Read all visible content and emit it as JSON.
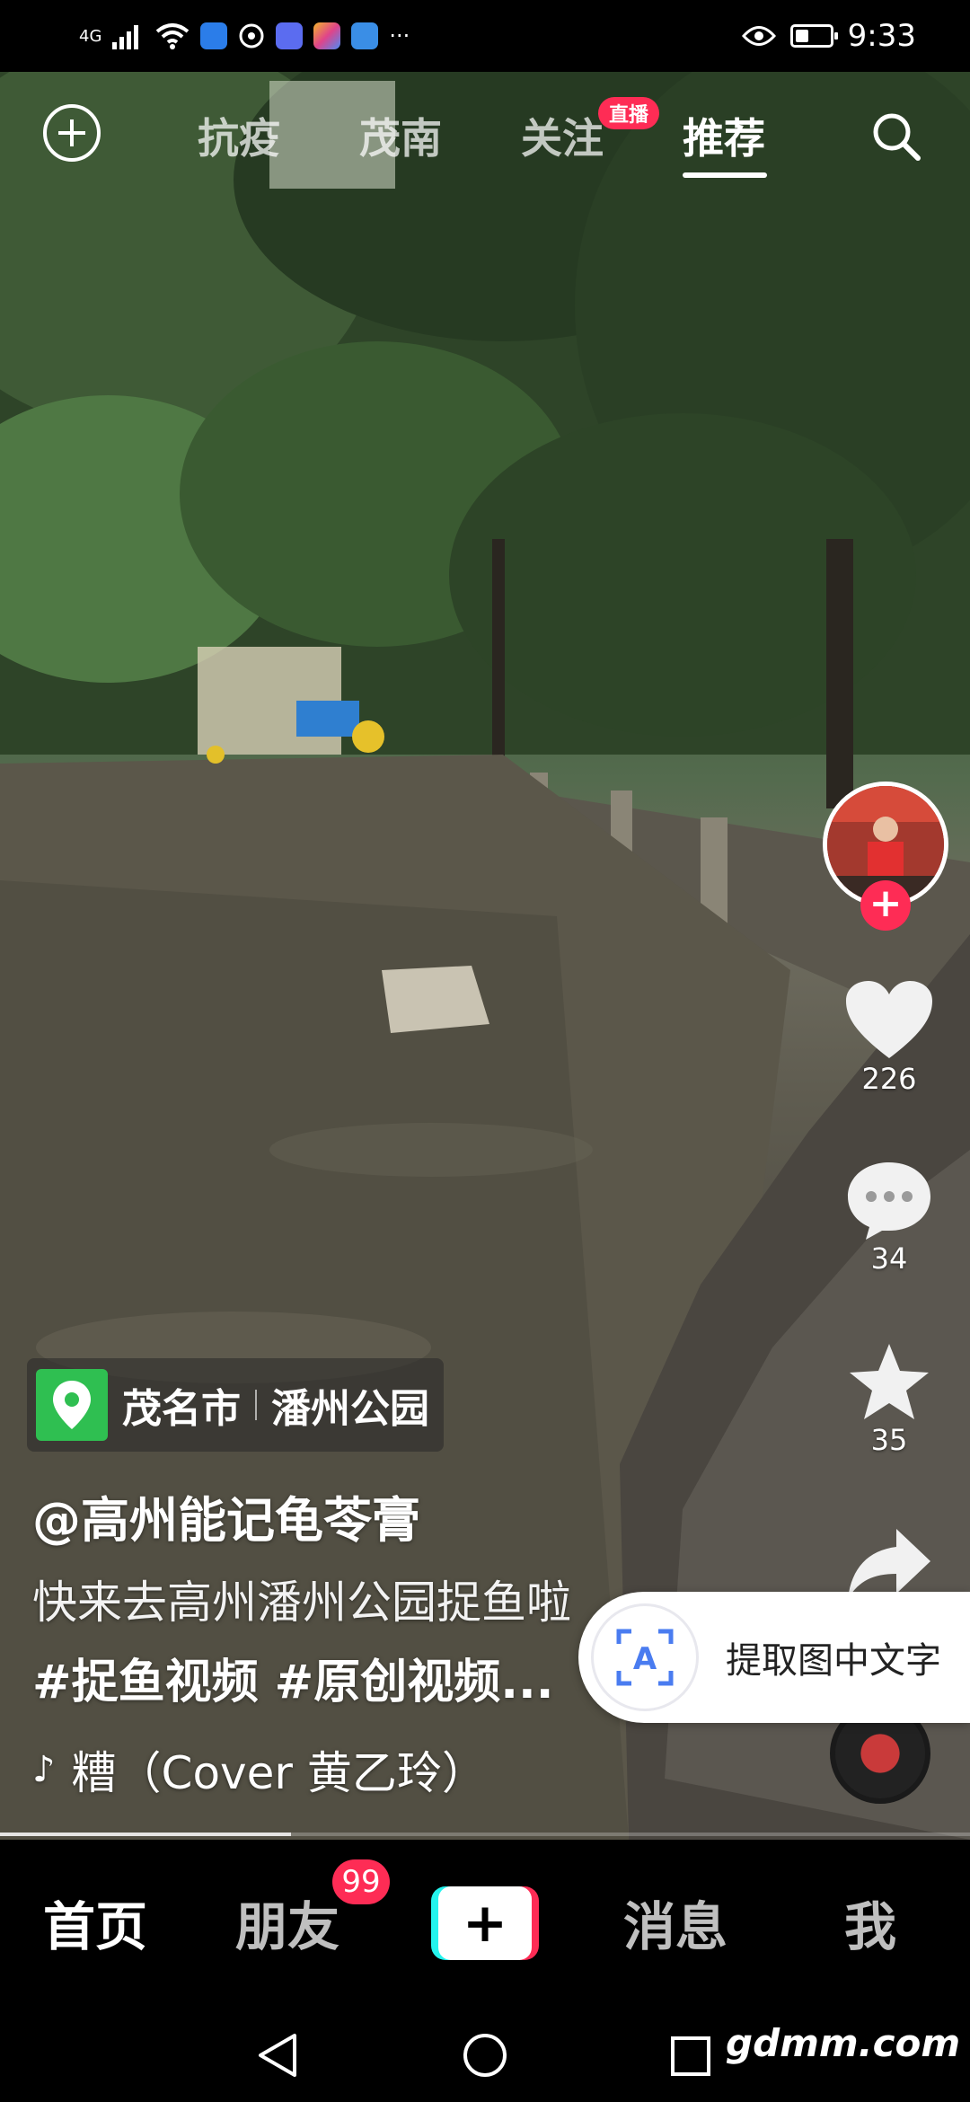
{
  "status_bar": {
    "network": "4G",
    "time": "9:33",
    "more": "···",
    "battery_level": 0.4
  },
  "top_tabs": [
    {
      "label": "抗疫",
      "active": false
    },
    {
      "label": "茂南",
      "active": false
    },
    {
      "label": "关注",
      "active": false,
      "badge": "直播"
    },
    {
      "label": "推荐",
      "active": true
    }
  ],
  "rail": {
    "likes": "226",
    "comments": "34",
    "favorites": "35"
  },
  "location": {
    "city": "茂名市",
    "place": "潘州公园"
  },
  "post": {
    "author": "@高州能记龟苓膏",
    "description": "快来去高州潘州公园捉鱼啦",
    "tags": "#捉鱼视频 #原创视频...",
    "music": "糟（Cover 黄乙玲）",
    "progress": 0.3
  },
  "extract_popup": {
    "label": "提取图中文字",
    "icon_text": "A"
  },
  "bottom_nav": {
    "home": "首页",
    "friends": "朋友",
    "friends_badge": "99",
    "create": "+",
    "messages": "消息",
    "me": "我"
  },
  "watermark": "gdmm.com",
  "colors": {
    "accent": "#fe2c55",
    "cyan": "#25f4ee",
    "location_green": "#2fbf51"
  }
}
